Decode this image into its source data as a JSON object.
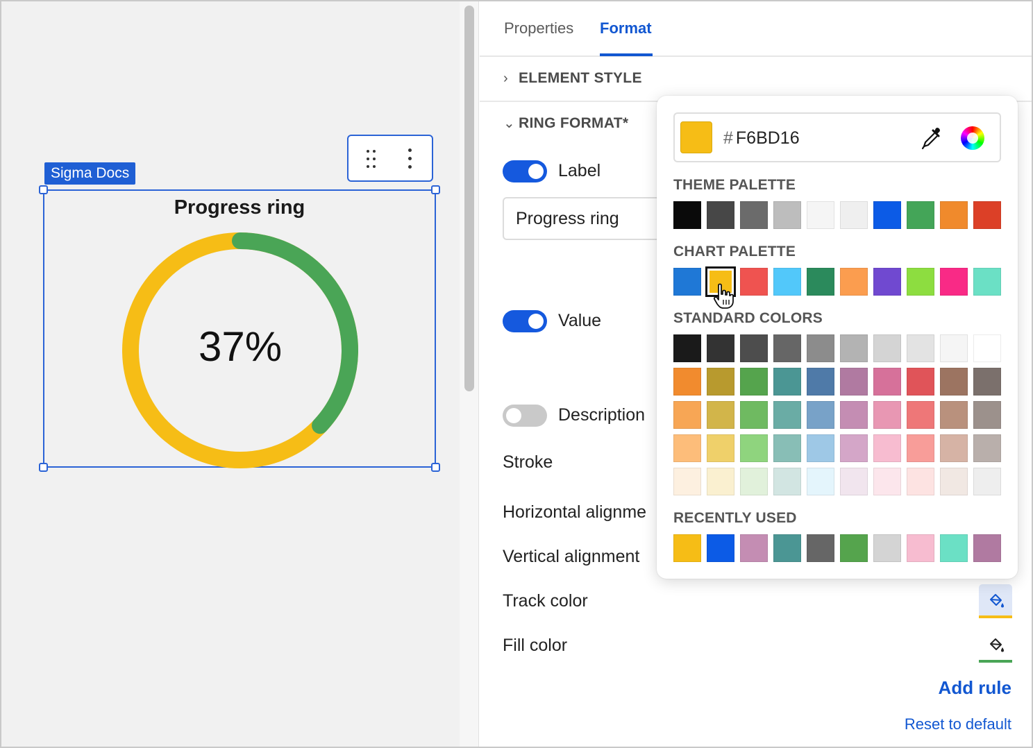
{
  "canvas": {
    "tag": "Sigma Docs",
    "element": {
      "title": "Progress ring",
      "value_text": "37%",
      "progress_percent": 37,
      "fill_color": "#4aa556",
      "track_color": "#F6BD16"
    }
  },
  "panel": {
    "tabs": [
      {
        "label": "Properties",
        "active": false
      },
      {
        "label": "Format",
        "active": true
      }
    ],
    "sections": {
      "element_style": "ELEMENT STYLE",
      "ring_format": "RING FORMAT*"
    },
    "label_toggle": {
      "label": "Label",
      "on": true
    },
    "label_value": "Progress ring",
    "value_toggle": {
      "label": "Value",
      "on": true
    },
    "description_toggle": {
      "label": "Description",
      "on": false
    },
    "stroke_label": "Stroke",
    "horizontal_alignment_label": "Horizontal alignme",
    "vertical_alignment_label": "Vertical alignment",
    "track_color_label": "Track color",
    "fill_color_label": "Fill color",
    "add_rule": "Add rule",
    "reset": "Reset to default"
  },
  "picker": {
    "hash": "#",
    "hex": "F6BD16",
    "selected_color": "#F6BD16",
    "theme_palette_title": "THEME PALETTE",
    "theme_palette": [
      "#0a0a0a",
      "#474747",
      "#6b6b6b",
      "#bdbdbd",
      "#f5f5f5",
      "#efefef",
      "#0c5be6",
      "#44a558",
      "#f08a2c",
      "#dc4027"
    ],
    "chart_palette_title": "CHART PALETTE",
    "chart_palette": [
      "#1f78d6",
      "#F6BD16",
      "#ef5350",
      "#52c8fa",
      "#2b8a5c",
      "#fb9d4f",
      "#7049d0",
      "#8ddd40",
      "#f92a86",
      "#6be0c5"
    ],
    "chart_selected_index": 1,
    "standard_colors_title": "STANDARD COLORS",
    "standard_colors": [
      [
        "#1a1a1a",
        "#333333",
        "#4d4d4d",
        "#666666",
        "#8c8c8c",
        "#b3b3b3",
        "#d4d4d4",
        "#e3e3e3",
        "#f5f5f5",
        "#ffffff"
      ],
      [
        "#f18b2e",
        "#b89a2e",
        "#55a44d",
        "#4b9694",
        "#4f7aa8",
        "#b07aa1",
        "#d6719a",
        "#e05459",
        "#9c7461",
        "#7b706c"
      ],
      [
        "#f7a655",
        "#d2b54a",
        "#6fba61",
        "#6aaca5",
        "#78a2c8",
        "#c48db3",
        "#e897b3",
        "#ee7778",
        "#b9917d",
        "#9c918c"
      ],
      [
        "#fdbd7a",
        "#efd06a",
        "#8fd47e",
        "#88beb6",
        "#9ec8e6",
        "#d4a6c8",
        "#f7bcd0",
        "#f89d99",
        "#d6b3a5",
        "#b9afab"
      ],
      [
        "#fdf0e0",
        "#faf0d0",
        "#e1f1db",
        "#d2e5e2",
        "#e4f5fc",
        "#f1e5ee",
        "#fce6ec",
        "#fde3e2",
        "#f1e8e3",
        "#eeeeee"
      ]
    ],
    "recently_used_title": "RECENTLY USED",
    "recently_used": [
      "#F6BD16",
      "#0c5be6",
      "#c48db3",
      "#4b9694",
      "#666666",
      "#55a44d",
      "#d4d4d4",
      "#f7bcd0",
      "#6be0c5",
      "#b07aa1"
    ]
  }
}
